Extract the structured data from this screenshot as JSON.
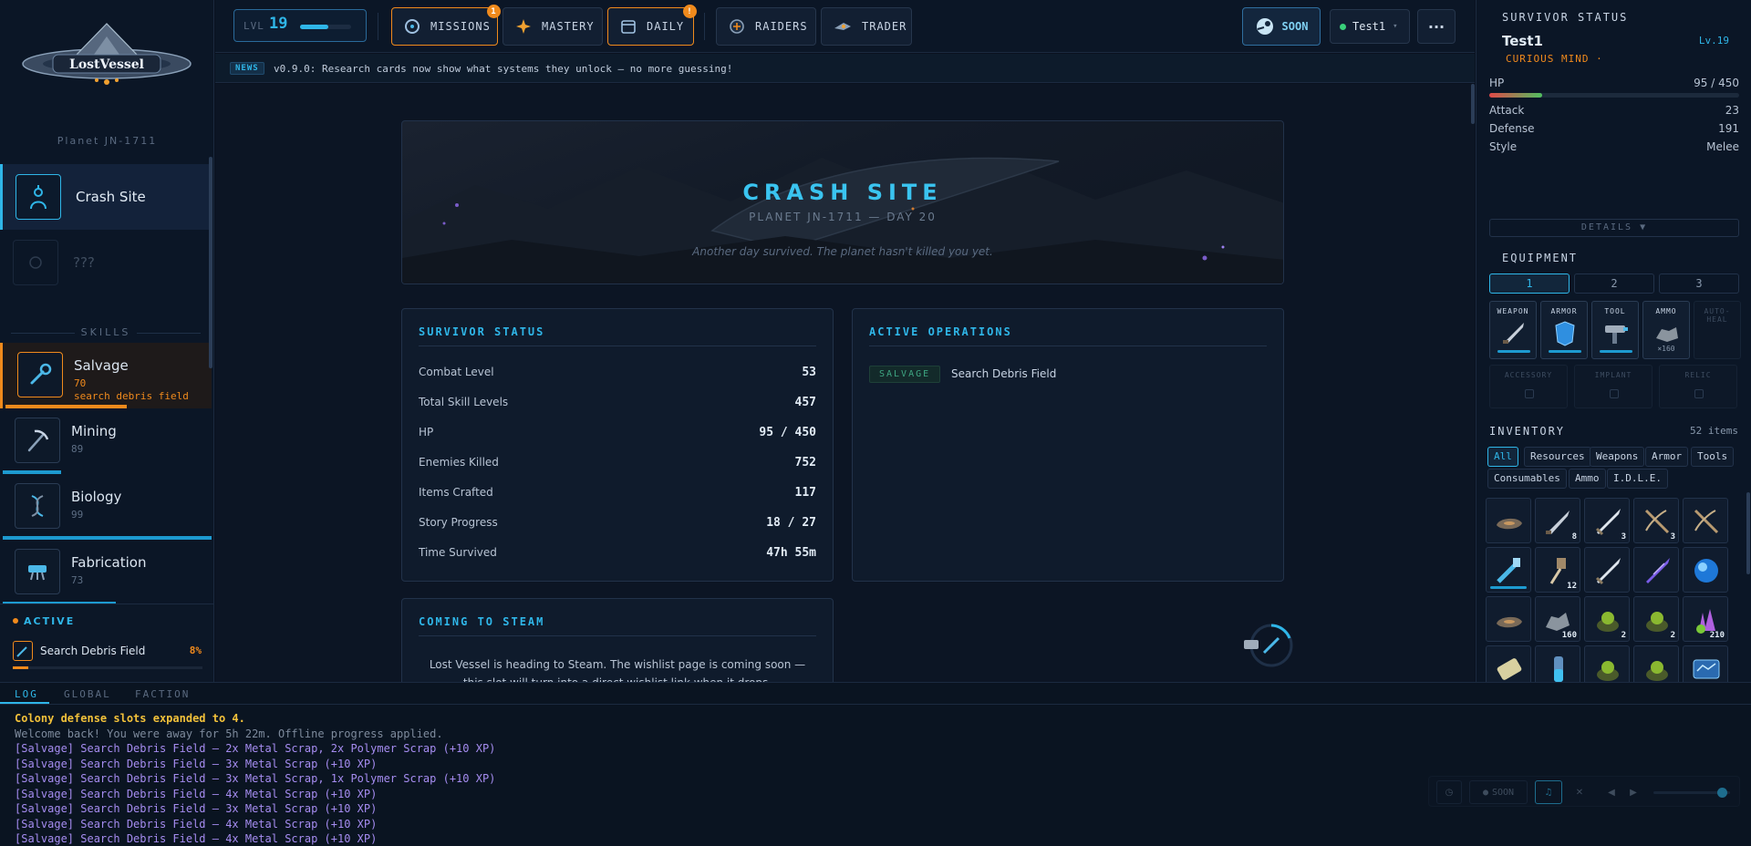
{
  "app": {
    "logo_text": "LostVessel",
    "planet": "Planet JN-1711"
  },
  "locations": [
    {
      "label": "Crash Site"
    },
    {
      "label": "???"
    }
  ],
  "skills": {
    "header": "SKILLS",
    "items": [
      {
        "name": "Salvage",
        "level": "70",
        "activity": "search debris field",
        "progress": 0.58
      },
      {
        "name": "Mining",
        "level": "89",
        "progress": 0.28
      },
      {
        "name": "Biology",
        "level": "99",
        "progress": 1.0
      },
      {
        "name": "Fabrication",
        "level": "73",
        "progress": 0.54
      }
    ]
  },
  "active": {
    "header": "ACTIVE",
    "name": "Search Debris Field",
    "percent": "8%",
    "progress": 0.08
  },
  "topbar": {
    "level_label": "LVL",
    "level_value": "19",
    "level_progress": 0.55,
    "buttons": [
      {
        "label": "MISSIONS",
        "badge": "1"
      },
      {
        "label": "MASTERY"
      },
      {
        "label": "DAILY",
        "badge": "!"
      },
      {
        "label": "RAIDERS"
      },
      {
        "label": "TRADER"
      }
    ],
    "soon_label": "SOON",
    "user": "Test1",
    "more": "···"
  },
  "news": {
    "tag": "NEWS",
    "text": "v0.9.0: Research cards now show what systems they unlock — no more guessing!"
  },
  "hero": {
    "title": "CRASH SITE",
    "subtitle": "PLANET JN-1711 — DAY 20",
    "note": "Another day survived. The planet hasn't killed you yet."
  },
  "status_card": {
    "title": "SURVIVOR STATUS",
    "rows": [
      {
        "k": "Combat Level",
        "v": "53"
      },
      {
        "k": "Total Skill Levels",
        "v": "457"
      },
      {
        "k": "HP",
        "v": "95 / 450"
      },
      {
        "k": "Enemies Killed",
        "v": "752"
      },
      {
        "k": "Items Crafted",
        "v": "117"
      },
      {
        "k": "Story Progress",
        "v": "18 / 27"
      },
      {
        "k": "Time Survived",
        "v": "47h 55m"
      }
    ]
  },
  "ops_card": {
    "title": "ACTIVE OPERATIONS",
    "tag": "SALVAGE",
    "name": "Search Debris Field"
  },
  "steam_card": {
    "title": "COMING TO STEAM",
    "text": "Lost Vessel is heading to Steam. The wishlist page is coming soon — this slot will turn into a direct wishlist link when it drops."
  },
  "right": {
    "header": "SURVIVOR STATUS",
    "name": "Test1",
    "level": "Lv.19",
    "trait": "CURIOUS MIND ·",
    "hp_label": "HP",
    "hp_value": "95 / 450",
    "hp_ratio": 0.211,
    "stats": [
      {
        "k": "Attack",
        "v": "23"
      },
      {
        "k": "Defense",
        "v": "191"
      },
      {
        "k": "Style",
        "v": "Melee"
      }
    ],
    "details": "DETAILS ▼",
    "equipment": {
      "header": "EQUIPMENT",
      "tabs": [
        "1",
        "2",
        "3"
      ],
      "slots": [
        {
          "label": "WEAPON"
        },
        {
          "label": "ARMOR"
        },
        {
          "label": "TOOL"
        },
        {
          "label": "AMMO",
          "count": "×160"
        },
        {
          "label": "AUTO-HEAL"
        }
      ],
      "extra": [
        {
          "label": "ACCESSORY"
        },
        {
          "label": "IMPLANT"
        },
        {
          "label": "RELIC"
        }
      ]
    },
    "inventory": {
      "header": "INVENTORY",
      "count": "52 items",
      "filters": [
        "All",
        "Resources",
        "Weapons",
        "Armor",
        "Tools",
        "Consumables",
        "Ammo",
        "I.D.L.E."
      ],
      "cells": [
        {
          "icon": "ore-icon",
          "n": ""
        },
        {
          "icon": "blade-icon",
          "n": "8"
        },
        {
          "icon": "sword-icon",
          "n": "3"
        },
        {
          "icon": "crossbow-icon",
          "n": "3"
        },
        {
          "icon": "crossbow-icon",
          "n": ""
        },
        {
          "icon": "blaster-icon",
          "n": ""
        },
        {
          "icon": "hammer-icon",
          "n": "12"
        },
        {
          "icon": "sword-icon",
          "n": ""
        },
        {
          "icon": "crystal-blade-icon",
          "n": ""
        },
        {
          "icon": "orb-icon",
          "n": ""
        },
        {
          "icon": "ore-icon",
          "n": ""
        },
        {
          "icon": "scrap-icon",
          "n": "160"
        },
        {
          "icon": "plant-icon",
          "n": "2"
        },
        {
          "icon": "plant-icon",
          "n": "2"
        },
        {
          "icon": "crystal-cluster-icon",
          "n": "210"
        },
        {
          "icon": "bandage-icon",
          "n": ""
        },
        {
          "icon": "vial-icon",
          "n": ""
        },
        {
          "icon": "plant-icon",
          "n": ""
        },
        {
          "icon": "plant-icon",
          "n": ""
        },
        {
          "icon": "device-icon",
          "n": ""
        }
      ]
    }
  },
  "log": {
    "tabs": [
      "LOG",
      "GLOBAL",
      "FACTION"
    ],
    "lines": [
      {
        "t": "Colony defense slots expanded to 4.",
        "c": "#f2c13a",
        "b": true
      },
      {
        "t": "Welcome back! You were away for 5h 22m. Offline progress applied.",
        "c": "#7d8a9c",
        "b": false
      },
      {
        "t": "[Salvage] Search Debris Field — 2x Metal Scrap, 2x Polymer Scrap (+10 XP)",
        "c": "#a58cf0",
        "b": false
      },
      {
        "t": "[Salvage] Search Debris Field — 3x Metal Scrap (+10 XP)",
        "c": "#a58cf0",
        "b": false
      },
      {
        "t": "[Salvage] Search Debris Field — 3x Metal Scrap, 1x Polymer Scrap (+10 XP)",
        "c": "#a58cf0",
        "b": false
      },
      {
        "t": "[Salvage] Search Debris Field — 4x Metal Scrap (+10 XP)",
        "c": "#a58cf0",
        "b": false
      },
      {
        "t": "[Salvage] Search Debris Field — 3x Metal Scrap (+10 XP)",
        "c": "#a58cf0",
        "b": false
      },
      {
        "t": "[Salvage] Search Debris Field — 4x Metal Scrap (+10 XP)",
        "c": "#a58cf0",
        "b": false
      },
      {
        "t": "[Salvage] Search Debris Field — 4x Metal Scrap (+10 XP)",
        "c": "#a58cf0",
        "b": false
      }
    ],
    "controls": {
      "soon": "SOON",
      "volume": 0.9
    }
  }
}
